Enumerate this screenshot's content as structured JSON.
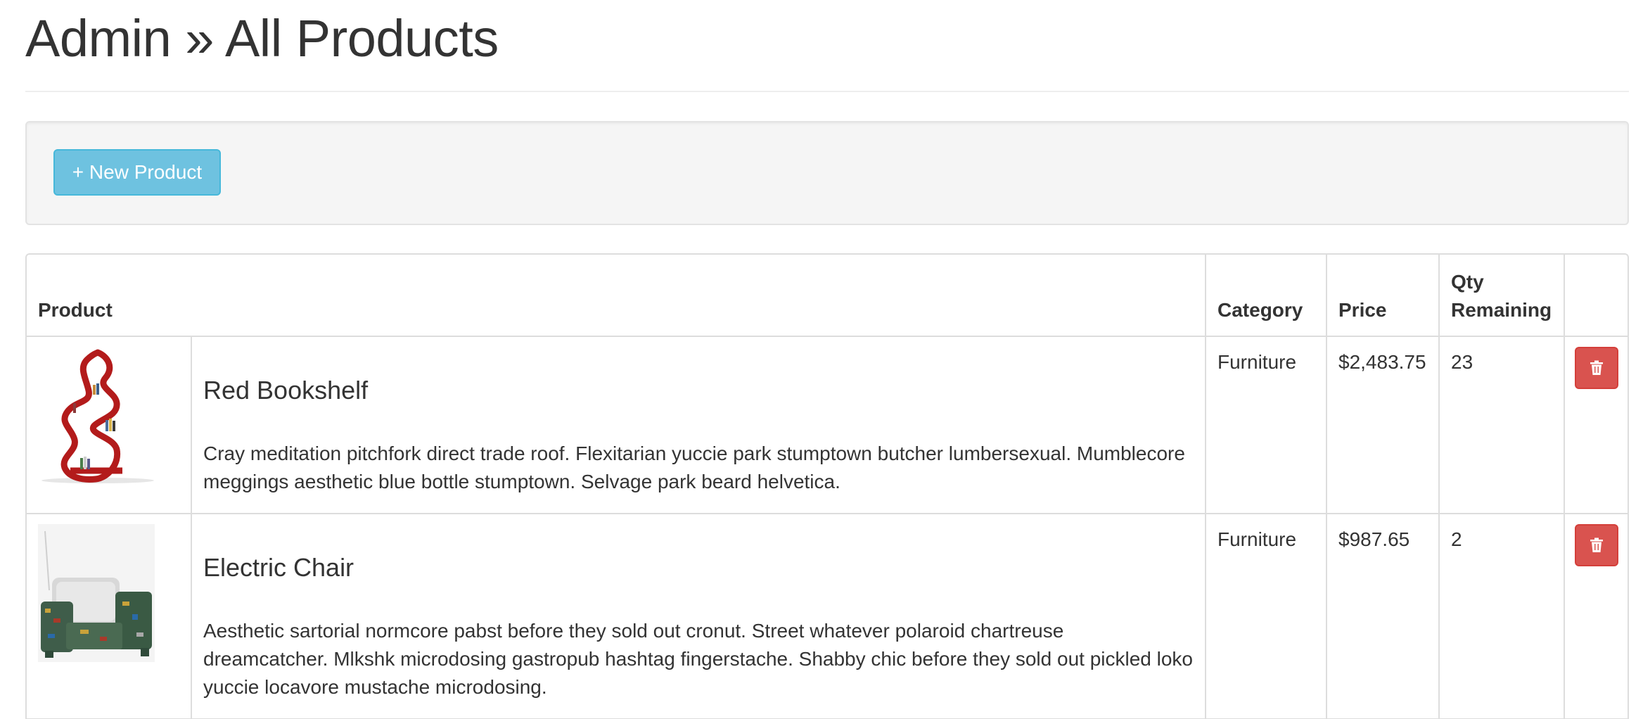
{
  "header": {
    "title": "Admin » All Products"
  },
  "toolbar": {
    "new_product_label": "+ New Product"
  },
  "table": {
    "columns": {
      "product": "Product",
      "category": "Category",
      "price": "Price",
      "qty_line1": "Qty",
      "qty_line2": "Remaining"
    },
    "rows": [
      {
        "name": "Red Bookshelf",
        "description": "Cray meditation pitchfork direct trade roof. Flexitarian yuccie park stumptown butcher lumbersexual. Mumblecore meggings aesthetic blue bottle stumptown. Selvage park beard helvetica.",
        "category": "Furniture",
        "price": "$2,483.75",
        "qty": "23",
        "image_icon": "red-bookshelf-image",
        "delete_icon": "trash-icon"
      },
      {
        "name": "Electric Chair",
        "description": "Aesthetic sartorial normcore pabst before they sold out cronut. Street whatever polaroid chartreuse dreamcatcher. Mlkshk microdosing gastropub hashtag fingerstache. Shabby chic before they sold out pickled loko yuccie locavore mustache microdosing.",
        "category": "Furniture",
        "price": "$987.65",
        "qty": "2",
        "image_icon": "electric-chair-image",
        "delete_icon": "trash-icon"
      }
    ]
  },
  "colors": {
    "new_button": "#6ec2e0",
    "delete_button": "#d9534f",
    "well_background": "#f5f5f5",
    "border": "#dddddd",
    "text": "#333333"
  }
}
